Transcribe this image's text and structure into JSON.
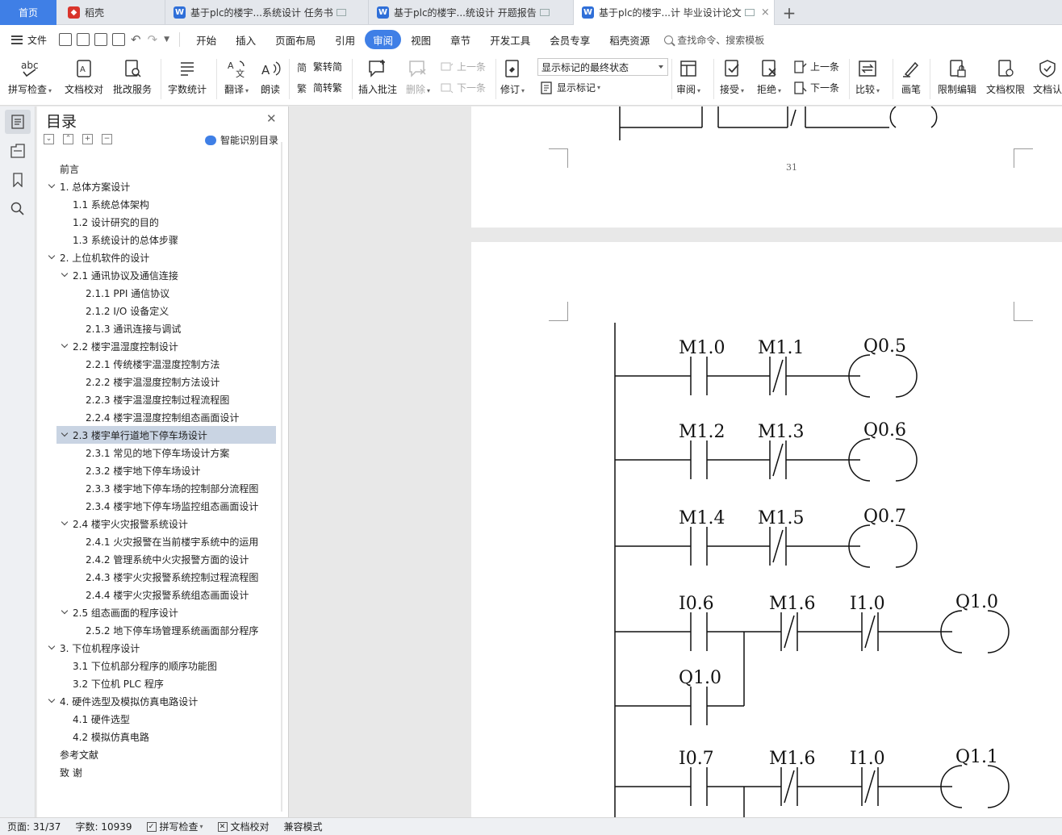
{
  "tabs": {
    "home": "首页",
    "wps": "稻壳",
    "doc1": "基于plc的楼宇...系统设计 任务书",
    "doc2": "基于plc的楼宇...统设计 开题报告",
    "doc3": "基于plc的楼宇...计 毕业设计论文",
    "close_symbol": "×",
    "add_symbol": "+"
  },
  "menu": {
    "file": "文件",
    "items": [
      "开始",
      "插入",
      "页面布局",
      "引用",
      "审阅",
      "视图",
      "章节",
      "开发工具",
      "会员专享",
      "稻壳资源"
    ],
    "active": "审阅",
    "search": "查找命令、搜索模板"
  },
  "ribbon": {
    "spell": "拼写检查",
    "proofread": "文档校对",
    "batch": "批改服务",
    "wordcount": "字数统计",
    "translate": "翻译",
    "read": "朗读",
    "trad": "繁转简",
    "simp": "简转繁",
    "insert_comment": "插入批注",
    "delete": "删除",
    "prev_comment": "上一条",
    "next_comment": "下一条",
    "revise": "修订",
    "markup_state": "显示标记的最终状态",
    "show_markup": "显示标记",
    "review": "审阅",
    "accept": "接受",
    "reject": "拒绝",
    "prev_change": "上一条",
    "next_change": "下一条",
    "compare": "比较",
    "pen": "画笔",
    "restrict": "限制编辑",
    "permission": "文档权限",
    "cert": "文档认"
  },
  "toc": {
    "title": "目录",
    "smart": "智能识别目录",
    "items": [
      {
        "text": "前言",
        "level": 0,
        "toggle": false,
        "selected": false
      },
      {
        "text": "1.  总体方案设计",
        "level": 0,
        "toggle": true,
        "selected": false
      },
      {
        "text": "1.1  系统总体架构",
        "level": 1,
        "toggle": false,
        "selected": false
      },
      {
        "text": "1.2  设计研究的目的",
        "level": 1,
        "toggle": false,
        "selected": false
      },
      {
        "text": "1.3  系统设计的总体步骤",
        "level": 1,
        "toggle": false,
        "selected": false
      },
      {
        "text": "2.  上位机软件的设计",
        "level": 0,
        "toggle": true,
        "selected": false
      },
      {
        "text": "2.1  通讯协议及通信连接",
        "level": 1,
        "toggle": true,
        "selected": false
      },
      {
        "text": "2.1.1 PPI 通信协议",
        "level": 2,
        "toggle": false,
        "selected": false
      },
      {
        "text": "2.1.2 I/O 设备定义",
        "level": 2,
        "toggle": false,
        "selected": false
      },
      {
        "text": "2.1.3  通讯连接与调试",
        "level": 2,
        "toggle": false,
        "selected": false
      },
      {
        "text": "2.2  楼宇温湿度控制设计",
        "level": 1,
        "toggle": true,
        "selected": false
      },
      {
        "text": "2.2.1  传统楼宇温湿度控制方法",
        "level": 2,
        "toggle": false,
        "selected": false
      },
      {
        "text": "2.2.2  楼宇温湿度控制方法设计",
        "level": 2,
        "toggle": false,
        "selected": false
      },
      {
        "text": "2.2.3  楼宇温湿度控制过程流程图",
        "level": 2,
        "toggle": false,
        "selected": false
      },
      {
        "text": "2.2.4  楼宇温湿度控制组态画面设计",
        "level": 2,
        "toggle": false,
        "selected": false
      },
      {
        "text": "2.3  楼宇单行道地下停车场设计",
        "level": 1,
        "toggle": true,
        "selected": true
      },
      {
        "text": "2.3.1  常见的地下停车场设计方案",
        "level": 2,
        "toggle": false,
        "selected": false
      },
      {
        "text": "2.3.2  楼宇地下停车场设计",
        "level": 2,
        "toggle": false,
        "selected": false
      },
      {
        "text": "2.3.3  楼宇地下停车场的控制部分流程图",
        "level": 2,
        "toggle": false,
        "selected": false
      },
      {
        "text": "2.3.4  楼宇地下停车场监控组态画面设计",
        "level": 2,
        "toggle": false,
        "selected": false
      },
      {
        "text": "2.4  楼宇火灾报警系统设计",
        "level": 1,
        "toggle": true,
        "selected": false
      },
      {
        "text": "2.4.1  火灾报警在当前楼宇系统中的运用",
        "level": 2,
        "toggle": false,
        "selected": false
      },
      {
        "text": "2.4.2  管理系统中火灾报警方面的设计",
        "level": 2,
        "toggle": false,
        "selected": false
      },
      {
        "text": "2.4.3  楼宇火灾报警系统控制过程流程图",
        "level": 2,
        "toggle": false,
        "selected": false
      },
      {
        "text": "2.4.4  楼宇火灾报警系统组态画面设计",
        "level": 2,
        "toggle": false,
        "selected": false
      },
      {
        "text": "2.5  组态画面的程序设计",
        "level": 1,
        "toggle": true,
        "selected": false
      },
      {
        "text": "2.5.2  地下停车场管理系统画面部分程序",
        "level": 2,
        "toggle": false,
        "selected": false
      },
      {
        "text": "3.  下位机程序设计",
        "level": 0,
        "toggle": true,
        "selected": false
      },
      {
        "text": "3.1  下位机部分程序的顺序功能图",
        "level": 1,
        "toggle": false,
        "selected": false
      },
      {
        "text": "3.2  下位机 PLC 程序",
        "level": 1,
        "toggle": false,
        "selected": false
      },
      {
        "text": "4.  硬件选型及模拟仿真电路设计",
        "level": 0,
        "toggle": true,
        "selected": false
      },
      {
        "text": "4.1  硬件选型",
        "level": 1,
        "toggle": false,
        "selected": false
      },
      {
        "text": "4.2  模拟仿真电路",
        "level": 1,
        "toggle": false,
        "selected": false
      },
      {
        "text": "参考文献",
        "level": 0,
        "toggle": false,
        "selected": false
      },
      {
        "text": "致    谢",
        "level": 0,
        "toggle": false,
        "selected": false
      }
    ]
  },
  "document": {
    "page_number": "31",
    "rungs": [
      {
        "contacts": [
          "M1.0",
          "M1.1"
        ],
        "coil": "Q0.5"
      },
      {
        "contacts": [
          "M1.2",
          "M1.3"
        ],
        "coil": "Q0.6"
      },
      {
        "contacts": [
          "M1.4",
          "M1.5"
        ],
        "coil": "Q0.7"
      },
      {
        "contacts": [
          "I0.6",
          "M1.6",
          "I1.0"
        ],
        "coil": "Q1.0",
        "branch": "Q1.0"
      },
      {
        "contacts": [
          "I0.7",
          "M1.6",
          "I1.0"
        ],
        "coil": "Q1.1"
      }
    ]
  },
  "status": {
    "page": "页面: 31/37",
    "words": "字数: 10939",
    "spell": "拼写检查",
    "proof": "文档校对",
    "compat": "兼容模式"
  }
}
